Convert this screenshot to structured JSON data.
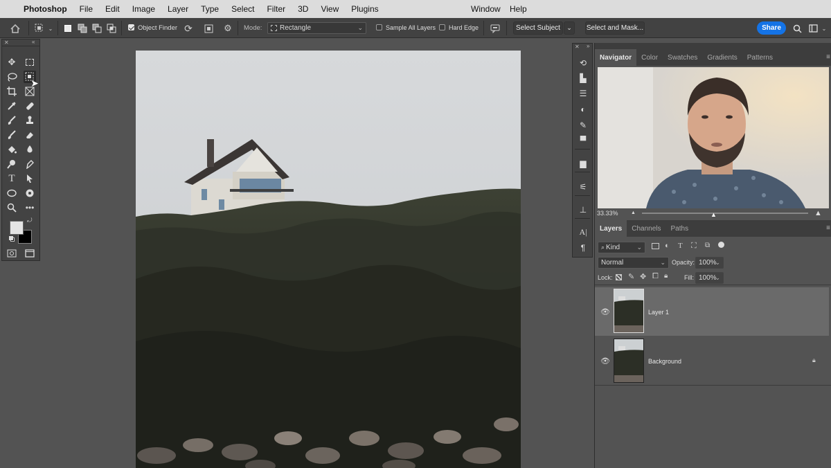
{
  "menubar": {
    "app": "Photoshop",
    "items": [
      "File",
      "Edit",
      "Image",
      "Layer",
      "Type",
      "Select",
      "Filter",
      "3D",
      "View",
      "Plugins"
    ],
    "right_items": [
      "Window",
      "Help"
    ]
  },
  "options": {
    "object_finder": "Object Finder",
    "mode_label": "Mode:",
    "mode_value": "Rectangle",
    "sample_all_layers": "Sample All Layers",
    "hard_edge": "Hard Edge",
    "select_subject": "Select Subject",
    "select_and_mask": "Select and Mask...",
    "share": "Share"
  },
  "panels": {
    "top_tabs": [
      "Navigator",
      "Color",
      "Swatches",
      "Gradients",
      "Patterns"
    ],
    "zoom": "33.33%",
    "layer_tabs": [
      "Layers",
      "Channels",
      "Paths"
    ],
    "kind": "Kind",
    "blend_mode": "Normal",
    "opacity_label": "Opacity:",
    "opacity_value": "100%",
    "lock_label": "Lock:",
    "fill_label": "Fill:",
    "fill_value": "100%",
    "layers": [
      {
        "name": "Layer 1",
        "selected": true
      },
      {
        "name": "Background",
        "locked": true
      }
    ]
  },
  "colors": {
    "accent": "#1473e6",
    "panel": "#535353",
    "toolbar": "#434343",
    "selected_layer": "#6a6a6a"
  }
}
